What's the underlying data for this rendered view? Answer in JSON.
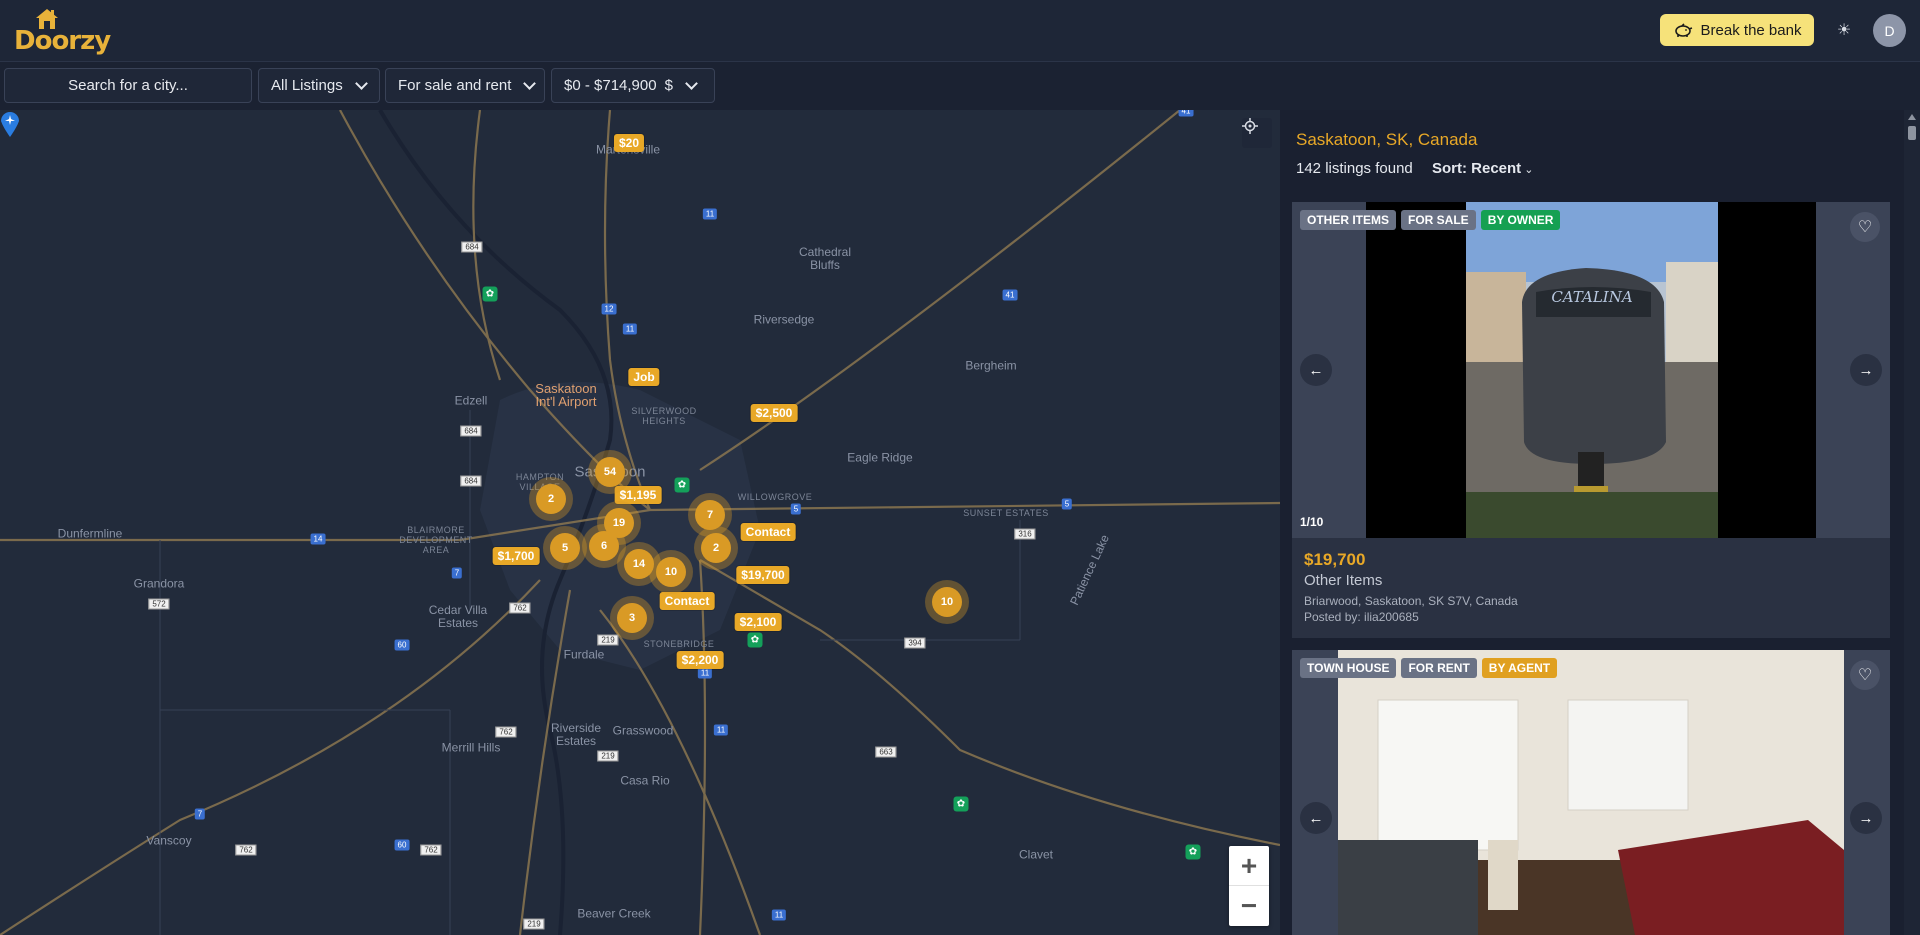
{
  "app": {
    "name": "Doorzy"
  },
  "header": {
    "bank_button": "Break the bank",
    "avatar_initial": "D"
  },
  "filters": {
    "search_placeholder": "Search for a city...",
    "listing_type": "All Listings",
    "sale_mode": "For sale and rent",
    "price_range": "$0 - $714,900",
    "currency": "$"
  },
  "map": {
    "price_pins": [
      "$20",
      "Job",
      "$2,500",
      "$1,195",
      "Contact",
      "$1,700",
      "$19,700",
      "Contact",
      "$2,100",
      "$2,200"
    ],
    "clusters": [
      "54",
      "2",
      "19",
      "7",
      "5",
      "6",
      "2",
      "14",
      "10",
      "3",
      "10"
    ],
    "towns": [
      "Martensville",
      "Cathedral Bluffs",
      "Riversedge",
      "Bergheim",
      "Edzell",
      "Eagle Ridge",
      "Dunfermline",
      "Grandora",
      "Cedar Villa Estates",
      "Furdale",
      "Merrill Hills",
      "Riverside Estates",
      "Grasswood",
      "Casa Rio",
      "Vanscoy",
      "Beaver Creek",
      "Clavet",
      "Patience Lake",
      "Saskatoon",
      "Saskatoon Int'l Airport"
    ],
    "areas": [
      "SILVERWOOD HEIGHTS",
      "WILLOWGROVE",
      "SUNSET ESTATES",
      "BLAIRMORE DEVELOPMENT AREA",
      "HAMPTON VILLAGE",
      "STONEBRIDGE"
    ],
    "zoom_in": "+",
    "zoom_out": "−"
  },
  "results": {
    "location": "Saskatoon, SK, Canada",
    "count_text": "142 listings found",
    "sort_label": "Sort: Recent",
    "listings": [
      {
        "badges": [
          "OTHER ITEMS",
          "FOR SALE",
          "BY OWNER"
        ],
        "image_counter": "1/10",
        "price": "$19,700",
        "category": "Other Items",
        "address": "Briarwood, Saskatoon, SK S7V, Canada",
        "posted_by": "Posted by: ilia200685"
      },
      {
        "badges": [
          "TOWN HOUSE",
          "FOR RENT",
          "BY AGENT"
        ]
      }
    ]
  },
  "colors": {
    "accent": "#e8a827",
    "bank": "#f6e27a",
    "background": "#1b2230",
    "owner_green": "#15a052",
    "agent_orange": "#e0a020"
  }
}
